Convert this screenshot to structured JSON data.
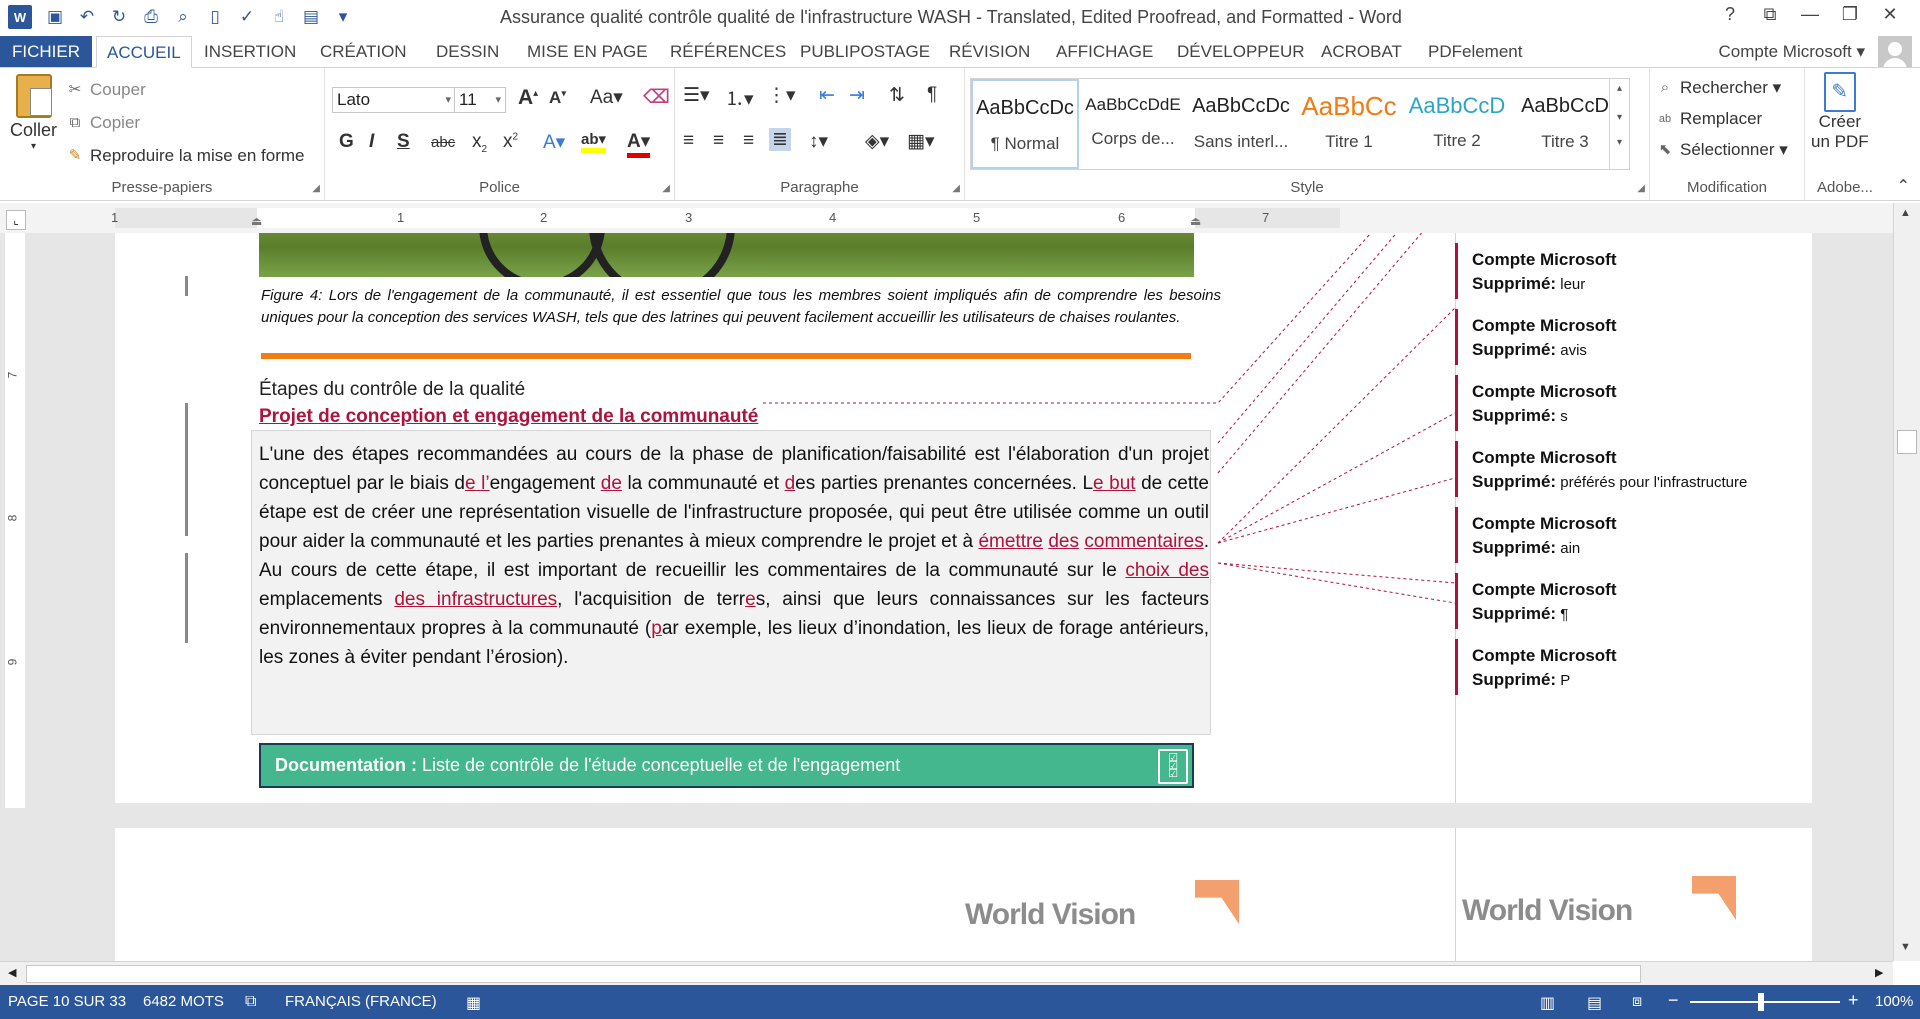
{
  "title_bar": {
    "document_title": "Assurance qualité  contrôle qualité de l'infrastructure WASH - Translated, Edited Proofread, and Formatted - Word",
    "help": "?",
    "window_controls": [
      "⧉",
      "—",
      "❐",
      "✕"
    ]
  },
  "tabs": [
    "FICHIER",
    "ACCUEIL",
    "INSERTION",
    "CRÉATION",
    "DESSIN",
    "MISE EN PAGE",
    "RÉFÉRENCES",
    "PUBLIPOSTAGE",
    "RÉVISION",
    "AFFICHAGE",
    "DÉVELOPPEUR",
    "ACROBAT",
    "PDFelement"
  ],
  "active_tab": "ACCUEIL",
  "account": "Compte Microsoft",
  "ribbon": {
    "clipboard": {
      "paste": "Coller",
      "cut": "Couper",
      "copy": "Copier",
      "format_painter": "Reproduire la mise en forme",
      "label": "Presse-papiers"
    },
    "font": {
      "name": "Lato",
      "size": "11",
      "label": "Police"
    },
    "paragraph": {
      "label": "Paragraphe"
    },
    "styles": {
      "items": [
        {
          "preview": "AaBbCcDc",
          "name": "¶ Normal",
          "color": "#222222"
        },
        {
          "preview": "AaBbCcDdE",
          "name": "Corps de...",
          "color": "#222222"
        },
        {
          "preview": "AaBbCcDc",
          "name": "Sans interl...",
          "color": "#222222"
        },
        {
          "preview": "AaBbCc",
          "name": "Titre 1",
          "color": "#f07c12"
        },
        {
          "preview": "AaBbCcD",
          "name": "Titre 2",
          "color": "#2aa5c4"
        },
        {
          "preview": "AaBbCcD",
          "name": "Titre 3",
          "color": "#222222"
        }
      ],
      "label": "Style"
    },
    "editing": {
      "find": "Rechercher",
      "replace": "Remplacer",
      "select": "Sélectionner",
      "label": "Modification"
    },
    "adobe": {
      "create_pdf_line1": "Créer",
      "create_pdf_line2": "un PDF",
      "label": "Adobe..."
    }
  },
  "ruler": {
    "h_numbers": [
      "1",
      "1",
      "2",
      "3",
      "4",
      "5",
      "6",
      "7"
    ],
    "v_numbers": [
      "7",
      "8",
      "9"
    ]
  },
  "document": {
    "caption": "Figure 4: Lors de l'engagement de la communauté, il est essentiel que tous les membres soient impliqués afin de comprendre les besoins uniques pour la conception des services WASH, tels que des latrines qui peuvent facilement accueillir les utilisateurs de chaises roulantes.",
    "step_heading": "Étapes du contrôle de la qualité",
    "project_heading": "Projet de conception et engagement de la communauté",
    "body": {
      "p01": "L'une des étapes recommandées au cours de la phase de planification/faisabilité est l'élaboration d'un projet conceptuel par le biais d",
      "i01": "e l’",
      "p02": "engagement ",
      "i02": "de",
      "p03": " la communauté et ",
      "i03": "d",
      "p04": "es parties prenantes concernées. L",
      "i04": "e but",
      "p05": " de cette étape est de créer une représentation visuelle de l'infrastructure proposée, qui peut être utilisée comme un outil pour aider la communauté et les parties prenantes à mieux comprendre le projet et à ",
      "i05": "émettre",
      "p06": " ",
      "i06": "des",
      "p07": " ",
      "i07": "commentaires",
      "p08": ". Au cours de cette étape, il est important de recueillir les commentaires de la communauté sur le ",
      "i08": "choix des ",
      "p09": "emplacements ",
      "i09": "des infrastructures",
      "p10": ", l'acquisition de terr",
      "i10": "e",
      "p11": "s, ainsi que leurs connaissances sur les facteurs environnementaux propres à la communauté (",
      "i11": "p",
      "p12": "ar exemple, les lieux d’inondation, les lieux de forage antérieurs, les zones à éviter pendant l’érosion)."
    },
    "banner_bold": "Documentation :",
    "banner_text": " Liste de contrôle de l'étude conceptuelle et de l'engagement",
    "logo_text": "World Vision"
  },
  "comments": [
    {
      "author": "Compte Microsoft",
      "kind": "Supprimé:",
      "text": "leur"
    },
    {
      "author": "Compte Microsoft",
      "kind": "Supprimé:",
      "text": "avis"
    },
    {
      "author": "Compte Microsoft",
      "kind": "Supprimé:",
      "text": "s"
    },
    {
      "author": "Compte Microsoft",
      "kind": "Supprimé:",
      "text": "préférés pour l'infrastructure"
    },
    {
      "author": "Compte Microsoft",
      "kind": "Supprimé:",
      "text": "ain"
    },
    {
      "author": "Compte Microsoft",
      "kind": "Supprimé:",
      "text": "¶"
    },
    {
      "author": "Compte Microsoft",
      "kind": "Supprimé:",
      "text": "P"
    }
  ],
  "status": {
    "page": "PAGE 10 SUR 33",
    "words": "6482 MOTS",
    "language": "FRANÇAIS (FRANCE)",
    "zoom": "100%"
  },
  "colors": {
    "accent": "#2b579a",
    "revision": "#b0123b",
    "banner": "#45b78f",
    "rule": "#f07c12"
  }
}
